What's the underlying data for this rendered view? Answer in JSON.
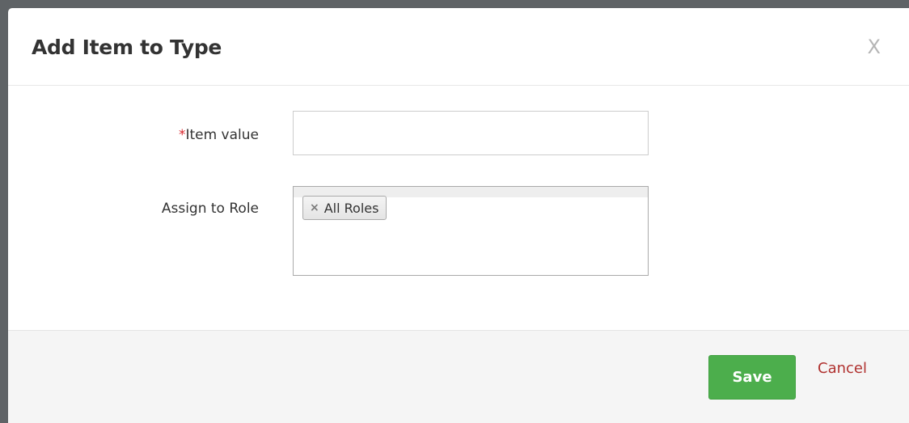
{
  "dialog": {
    "title": "Add Item to Type",
    "close_label": "X"
  },
  "form": {
    "item_value": {
      "required_marker": "*",
      "label": "Item value",
      "value": "",
      "placeholder": ""
    },
    "assign_role": {
      "label": "Assign to Role",
      "remove_glyph": "×",
      "selected": [
        "All Roles"
      ]
    }
  },
  "footer": {
    "save_label": "Save",
    "cancel_label": "Cancel"
  },
  "colors": {
    "save_button": "#4cae4c",
    "cancel_link": "#b0312f",
    "required_marker": "#d9262c"
  }
}
